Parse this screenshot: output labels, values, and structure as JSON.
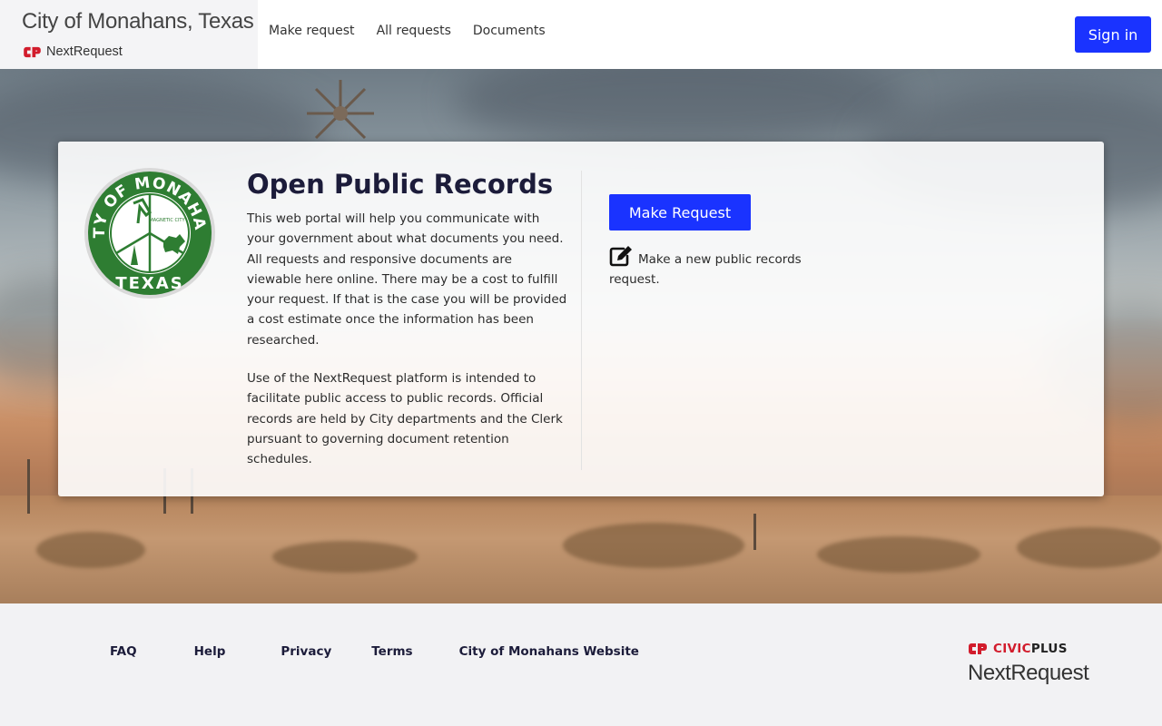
{
  "header": {
    "city_title": "City of Monahans, Texas",
    "brand_text": "NextRequest",
    "nav": [
      {
        "label": "Make request"
      },
      {
        "label": "All requests"
      },
      {
        "label": "Documents"
      }
    ],
    "sign_in_label": "Sign in"
  },
  "hero": {
    "card": {
      "seal_text_top": "CITY OF MONAHANS",
      "seal_text_bottom": "TEXAS",
      "seal_text_inner": "MAGNETIC CITY",
      "title": "Open Public Records",
      "paragraph_1": "This web portal will help you communicate with your government about what documents you need. All requests and responsive documents are viewable here online. There may be a cost to fulfill your request. If that is the case you will be provided a cost estimate once the information has been researched.",
      "paragraph_2": "Use of the NextRequest platform is intended to facilitate public access to public records. Official records are held by City departments and the Clerk pursuant to governing document retention schedules.",
      "make_request_label": "Make Request",
      "make_request_desc": "Make a new public records request.",
      "make_request_icon": "edit-icon"
    }
  },
  "footer": {
    "links": [
      {
        "label": "FAQ"
      },
      {
        "label": "Help"
      },
      {
        "label": "Privacy"
      },
      {
        "label": "Terms"
      },
      {
        "label": "City of Monahans Website"
      }
    ],
    "civicplus_civic": "CIVIC",
    "civicplus_plus": "PLUS",
    "nextrequest": "NextRequest"
  },
  "colors": {
    "primary_button": "#1a33ff",
    "brand_red": "#d21c2c",
    "heading": "#1c1c3a",
    "seal_green": "#2e7d32"
  }
}
